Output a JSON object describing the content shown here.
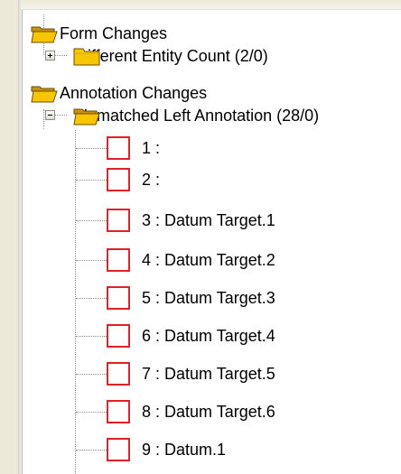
{
  "tree": {
    "groups": [
      {
        "label": "Form Changes"
      },
      {
        "label": "Annotation Changes"
      }
    ],
    "subgroups": [
      {
        "label": "Different Entity Count (2/0)",
        "state": "collapsed"
      },
      {
        "label": "Unmatched Left Annotation (28/0)",
        "state": "expanded"
      }
    ],
    "items": [
      {
        "label": "1 :"
      },
      {
        "label": "2 :"
      },
      {
        "label": "3 : Datum Target.1"
      },
      {
        "label": "4 : Datum Target.2"
      },
      {
        "label": "5 : Datum Target.3"
      },
      {
        "label": "6 : Datum Target.4"
      },
      {
        "label": "7 : Datum Target.5"
      },
      {
        "label": "8 : Datum Target.6"
      },
      {
        "label": "9 : Datum.1"
      }
    ]
  },
  "icons": {
    "folder": "folder-icon",
    "annotation": "annotation-icon",
    "expand": "expand-plus-icon",
    "collapse": "collapse-minus-icon"
  },
  "colors": {
    "folder_fill": "#f7c600",
    "annotation_border": "#e0212a"
  }
}
